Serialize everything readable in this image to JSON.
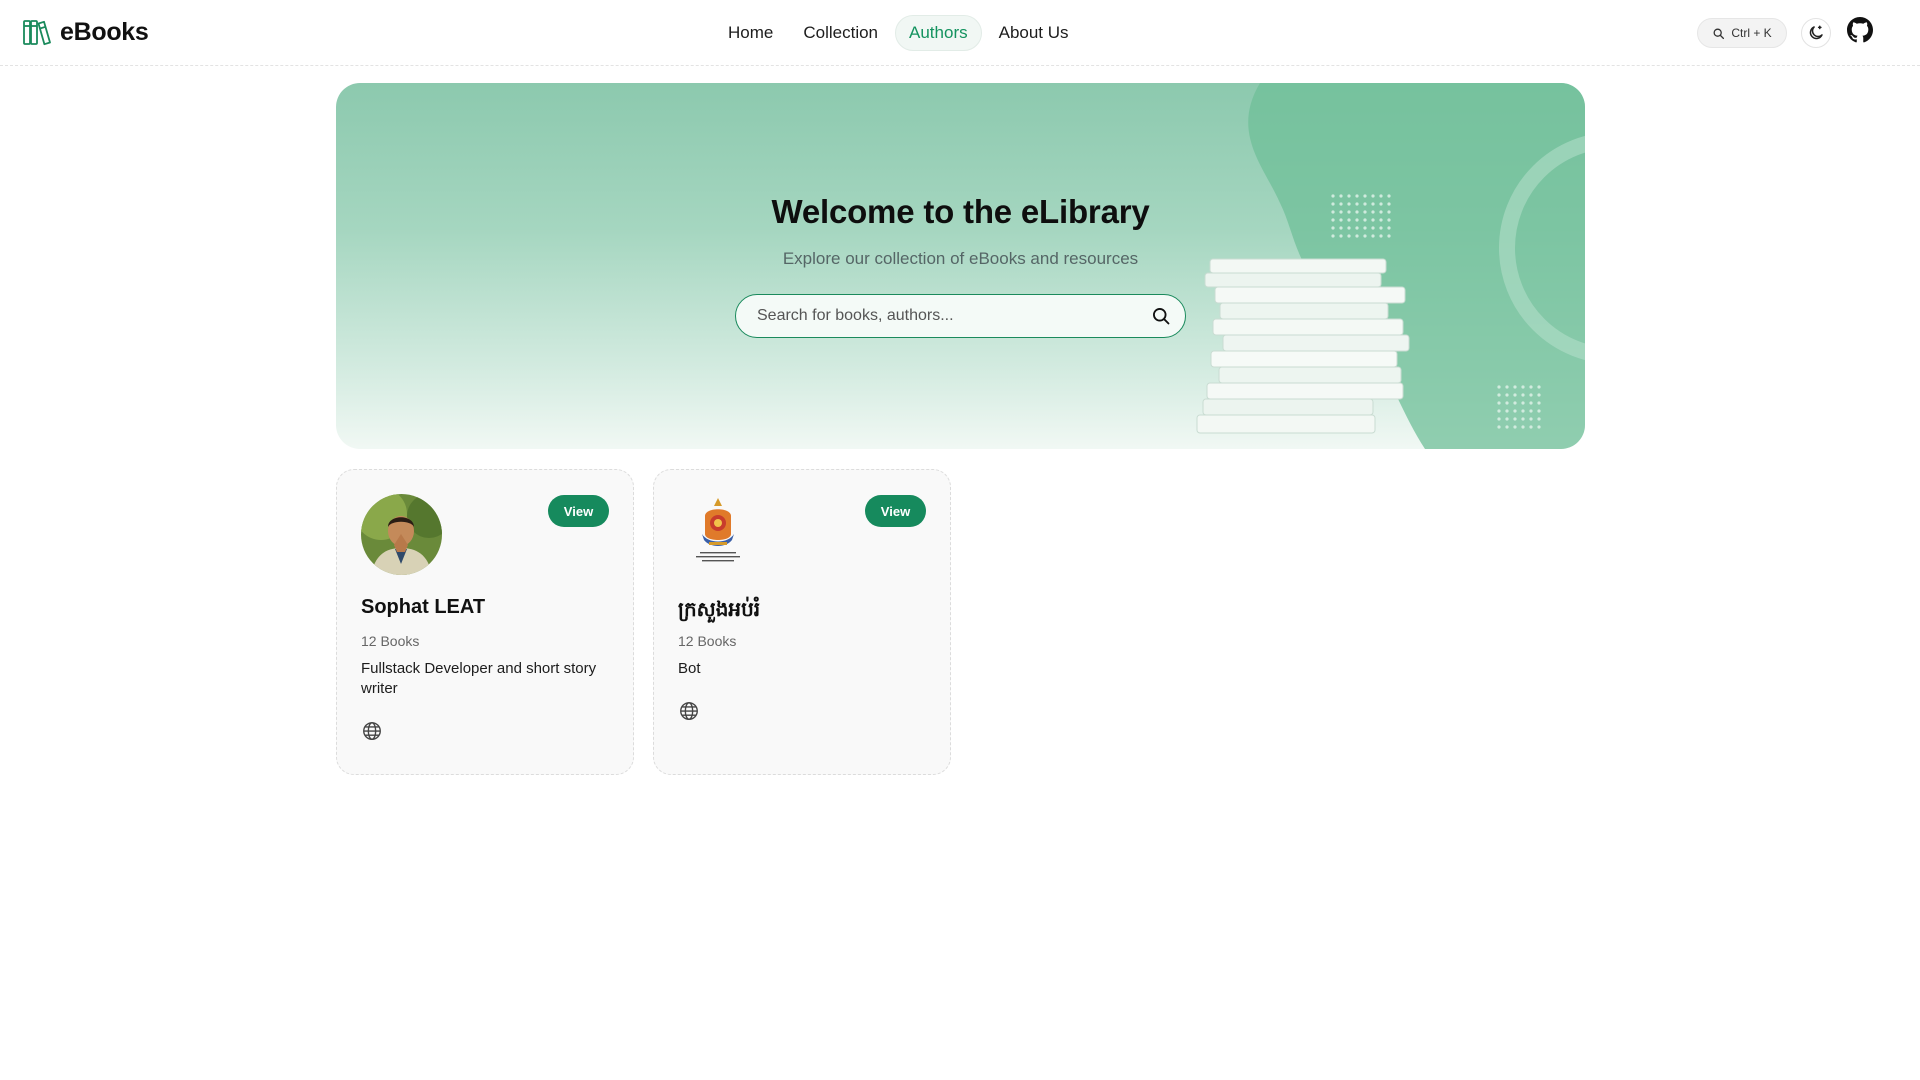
{
  "app": {
    "name": "eBooks"
  },
  "nav": {
    "items": [
      {
        "label": "Home",
        "active": false
      },
      {
        "label": "Collection",
        "active": false
      },
      {
        "label": "Authors",
        "active": true
      },
      {
        "label": "About Us",
        "active": false
      }
    ]
  },
  "header": {
    "search_shortcut": "Ctrl + K",
    "theme_icon": "moon-icon",
    "github_icon": "github-icon"
  },
  "hero": {
    "title": "Welcome to the eLibrary",
    "subtitle": "Explore our collection of eBooks and resources",
    "search_placeholder": "Search for books, authors...",
    "search_value": ""
  },
  "authors": [
    {
      "name": "Sophat LEAT",
      "books": "12 Books",
      "bio": "Fullstack Developer and short story writer",
      "view_label": "View",
      "website_icon": "globe-icon"
    },
    {
      "name": "ក្រសួងអប់រំ",
      "books": "12 Books",
      "bio": "Bot",
      "view_label": "View",
      "website_icon": "globe-icon"
    }
  ],
  "colors": {
    "accent": "#168a5d",
    "accent_text": "#14935f",
    "hero_top": "#8cc9ae"
  }
}
